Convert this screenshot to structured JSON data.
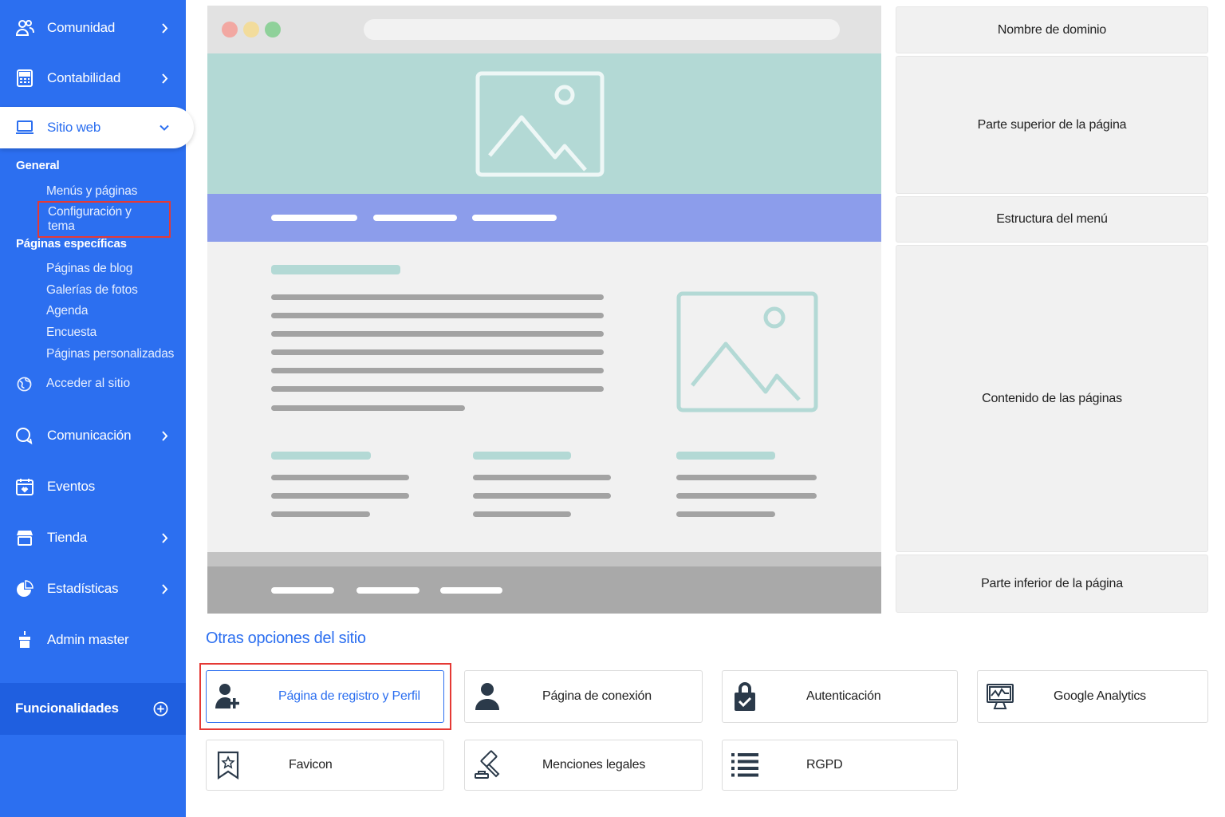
{
  "sidebar": {
    "items": [
      {
        "label": "Comunidad",
        "icon": "community-icon"
      },
      {
        "label": "Contabilidad",
        "icon": "calculator-icon"
      },
      {
        "label": "Sitio web",
        "icon": "laptop-icon"
      },
      {
        "label": "Comunicación",
        "icon": "chat-icon"
      },
      {
        "label": "Eventos",
        "icon": "calendar-icon"
      },
      {
        "label": "Tienda",
        "icon": "store-icon"
      },
      {
        "label": "Estadísticas",
        "icon": "pie-chart-icon"
      },
      {
        "label": "Admin master",
        "icon": "cake-icon"
      }
    ],
    "general_title": "General",
    "general_links": [
      "Menús y páginas",
      "Configuración y tema"
    ],
    "specific_title": "Páginas específicas",
    "specific_links": [
      "Páginas de blog",
      "Galerías de fotos",
      "Agenda",
      "Encuesta",
      "Páginas personalizadas"
    ],
    "access_site": "Acceder al sitio",
    "features": "Funcionalidades"
  },
  "sections": {
    "domain": "Nombre de dominio",
    "header": "Parte superior de la página",
    "menu": "Estructura del menú",
    "content": "Contenido de las páginas",
    "footer": "Parte inferior de la página"
  },
  "other_options": {
    "title": "Otras opciones del sitio",
    "items": [
      {
        "label": "Página de registro y Perfil",
        "icon": "user-add-icon"
      },
      {
        "label": "Página de conexión",
        "icon": "user-icon"
      },
      {
        "label": "Autenticación",
        "icon": "lock-check-icon"
      },
      {
        "label": "Google Analytics",
        "icon": "monitor-chart-icon"
      },
      {
        "label": "Favicon",
        "icon": "bookmark-star-icon"
      },
      {
        "label": "Menciones legales",
        "icon": "gavel-icon"
      },
      {
        "label": "RGPD",
        "icon": "list-icon"
      }
    ]
  },
  "colors": {
    "primary": "#2c6ff0",
    "highlight": "#e53935",
    "hero": "#b3d9d5",
    "menubar": "#8c9deb"
  }
}
